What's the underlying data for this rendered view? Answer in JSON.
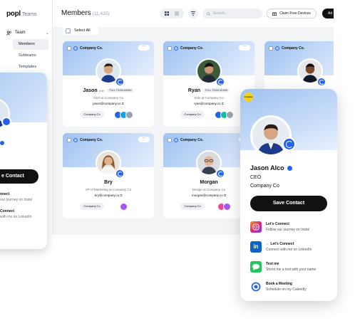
{
  "app": {
    "logo_text": "popl",
    "logo_sub": "Teams"
  },
  "sidebar": {
    "team_label": "Team",
    "items": [
      {
        "label": "Members",
        "active": true
      },
      {
        "label": "Subteams",
        "active": false
      },
      {
        "label": "Templates",
        "active": false
      }
    ]
  },
  "header": {
    "title": "Members",
    "count": "(11,425)",
    "search_placeholder": "Search...",
    "claim_label": "Claim Free Devices",
    "add_label": "Ad"
  },
  "select_all_label": "Select All",
  "cards": [
    {
      "company_chip": "Company Co.",
      "name": "Jason",
      "sub": "(He)",
      "role_tag": "FULL TEAM ADMIN",
      "job": "CEO at Company Co",
      "email": "jason@company.co",
      "company": "Company Co",
      "avatar_colors": [
        "#2563eb",
        "#0ea5e9",
        "#9ca3af"
      ]
    },
    {
      "company_chip": "Company Co.",
      "name": "Ryan",
      "sub": "",
      "role_tag": "FULL TEAM ADMIN",
      "job": "Sale at Company Co",
      "email": "ryan@company.co",
      "company": "Company Co",
      "avatar_colors": [
        "#2563eb",
        "#14b8a6",
        "#9ca3af"
      ]
    },
    {
      "company_chip": "Company Co.",
      "name": "",
      "sub": "",
      "role_tag": "",
      "job": "",
      "email": "",
      "company": "",
      "avatar_colors": []
    },
    {
      "company_chip": "Company Co.",
      "name": "Bry",
      "sub": "",
      "role_tag": "",
      "job": "VP of Marketing at Company Co",
      "email": "bry@company.co",
      "company": "Company Co",
      "avatar_colors": [
        "#a855f7"
      ]
    },
    {
      "company_chip": "Company Co.",
      "name": "Morgan",
      "sub": "",
      "role_tag": "",
      "job": "Design at Company Co",
      "email": "morgan@company.co",
      "company": "Company Co",
      "avatar_colors": [
        "#ec4899",
        "#a855f7"
      ]
    }
  ],
  "phone_left": {
    "save_label": "e Contact",
    "links": [
      {
        "title": "nnect",
        "subtitle": "our journey on Insta!"
      },
      {
        "title": "Connect",
        "subtitle": "with me on LinkedIn"
      }
    ]
  },
  "phone_right": {
    "logo_badge": "Company",
    "name": "Jason Alco",
    "title": "CEO",
    "company": "Company Co",
    "save_label": "Save Contact",
    "links": [
      {
        "title": "Let's Connect",
        "subtitle": "Follow our journey on Insta!",
        "icon": "instagram-icon",
        "color": "#c026d3"
      },
      {
        "title": "← Let's Connect",
        "subtitle": "Connect with me on LinkedIn",
        "icon": "linkedin-icon",
        "color": "#0a66c2"
      },
      {
        "title": "Text me",
        "subtitle": "Shoot me a text with your name",
        "icon": "message-icon",
        "color": "#22c55e"
      },
      {
        "title": "Book a Meeting",
        "subtitle": "Schedule on my Calendly",
        "icon": "calendly-icon",
        "color": "#2563eb"
      }
    ]
  }
}
